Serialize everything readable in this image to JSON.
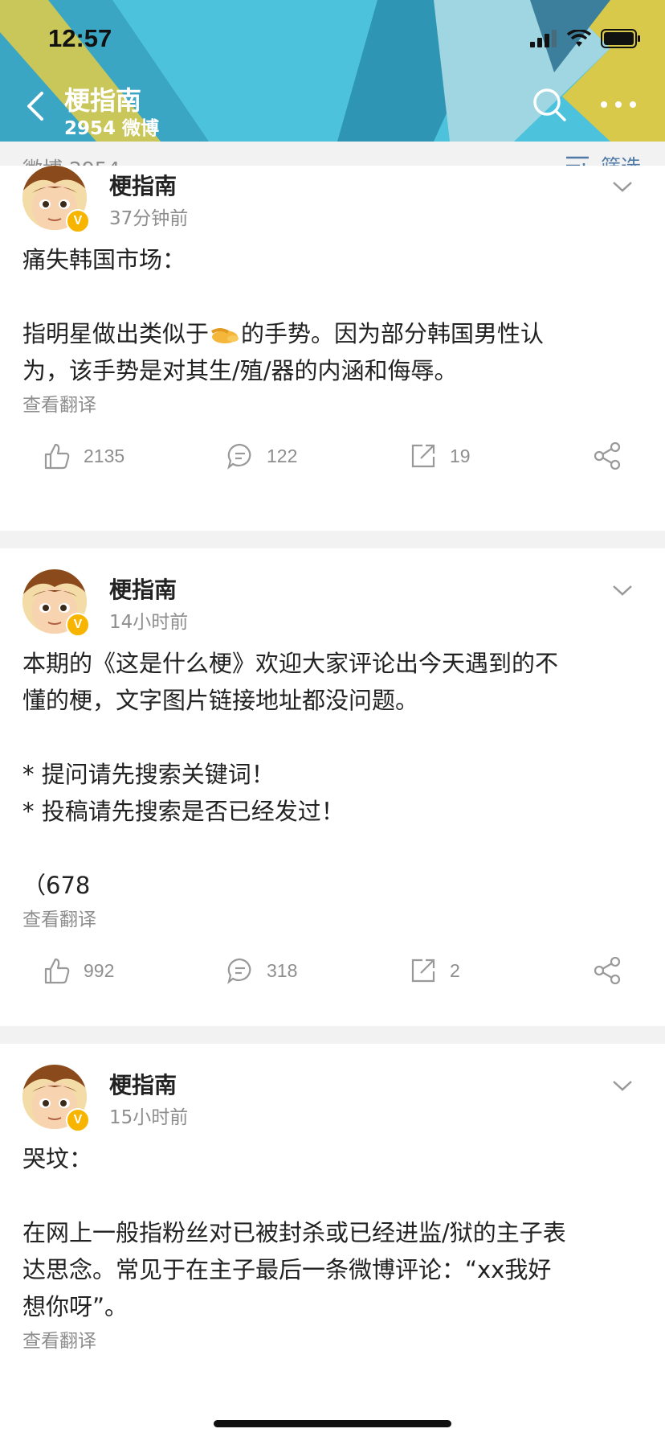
{
  "status": {
    "time": "12:57"
  },
  "header": {
    "title": "梗指南",
    "subtitle": "2954 微博"
  },
  "filterbar": {
    "count": "微博 2954",
    "filter_label": "筛选"
  },
  "posts": [
    {
      "author": "梗指南",
      "time": "37分钟前",
      "lines": [
        "痛失韩国市场：",
        "",
        "指明星做出类似于",
        "的手势。因为部分韩国男性认",
        "为，该手势是对其生/殖/器的内涵和侮辱。"
      ],
      "translate": "查看翻译",
      "likes": "2135",
      "comments": "122",
      "reposts": "19"
    },
    {
      "author": "梗指南",
      "time": "14小时前",
      "text": "本期的《这是什么梗》欢迎大家评论出今天遇到的不\n懂的梗，文字图片链接地址都没问题。\n\n* 提问请先搜索关键词！\n* 投稿请先搜索是否已经发过！\n\n（678",
      "translate": "查看翻译",
      "likes": "992",
      "comments": "318",
      "reposts": "2"
    },
    {
      "author": "梗指南",
      "time": "15小时前",
      "text": "哭坟：\n\n在网上一般指粉丝对已被封杀或已经进监/狱的主子表\n达思念。常见于在主子最后一条微博评论：“xx我好\n想你呀”。",
      "translate": "查看翻译"
    }
  ],
  "colors": {
    "accent_blue": "#4f7aa8",
    "header_teal": "#4cc2dc",
    "header_yellow": "#d8c94a",
    "badge": "#f7b500"
  },
  "icons": [
    "back-icon",
    "search-icon",
    "more-icon",
    "filter-icon",
    "chevron-down-icon",
    "like-icon",
    "comment-icon",
    "repost-icon",
    "share-icon",
    "verified-icon"
  ]
}
